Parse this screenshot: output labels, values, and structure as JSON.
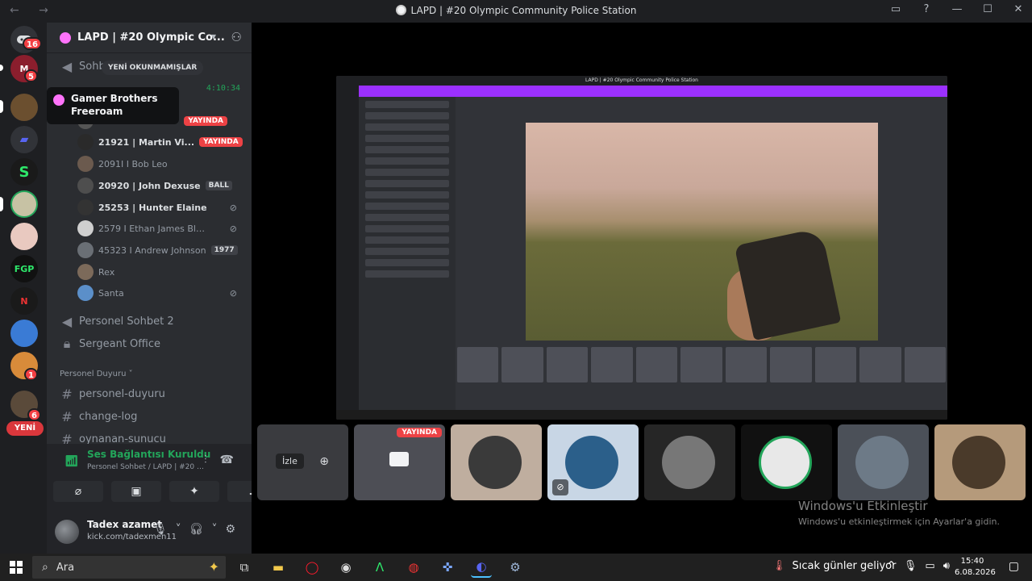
{
  "window": {
    "title": "LAPD | #20 Olympic Community Police Station",
    "nav": "← →"
  },
  "rail": {
    "badges": [
      "16",
      "5",
      "1",
      "6"
    ],
    "new_label": "YENİ"
  },
  "server": {
    "name": "LAPD | #20 Olympic Co...",
    "new_unread": "YENİ OKUNMAMIŞLAR",
    "timer": "4:10:34"
  },
  "tooltip": "Gamer Brothers Freeroam",
  "channels": {
    "sohbet": "Sohbet",
    "personel_sohbet_2": "Personel Sohbet 2",
    "sergeant_office": "Sergeant Office",
    "category_duyuru": "Personel Duyuru",
    "personel_duyuru": "personel-duyuru",
    "change_log": "change-log",
    "oynanan_sunucu": "oynanan-sunucu"
  },
  "members": [
    {
      "name": "",
      "live": "YAYINDA"
    },
    {
      "name": "21921 | Martin Vi...",
      "live": "YAYINDA"
    },
    {
      "name": "2091I I Bob Leo"
    },
    {
      "name": "20920 | John Dexuse",
      "tag": "BALL"
    },
    {
      "name": "25253 | Hunter Elaine"
    },
    {
      "name": "2579 I Ethan James Black..."
    },
    {
      "name": "45323 I Andrew Johnson",
      "tag": "1977"
    },
    {
      "name": "Rex"
    },
    {
      "name": "Santa"
    }
  ],
  "voice": {
    "status": "Ses Bağlantısı Kuruldu",
    "sub": "Personel Sohbet / LAPD | #20 Olympic ..."
  },
  "user": {
    "name": "Tadex azamet",
    "sub": "kick.com/tadexmen11"
  },
  "stage": {
    "izle": "İzle",
    "live": "YAYINDA"
  },
  "watermark": {
    "title": "Windows'u Etkinleştir",
    "sub": "Windows'u etkinleştirmek için Ayarlar'a gidin."
  },
  "taskbar": {
    "search_placeholder": "Ara",
    "weather": "Sıcak günler geliyor",
    "time": "15:40",
    "date": "6.08.2026"
  },
  "colors": {
    "accent_green": "#23a55a",
    "live_red": "#ed4245",
    "blurple": "#5865f2"
  }
}
